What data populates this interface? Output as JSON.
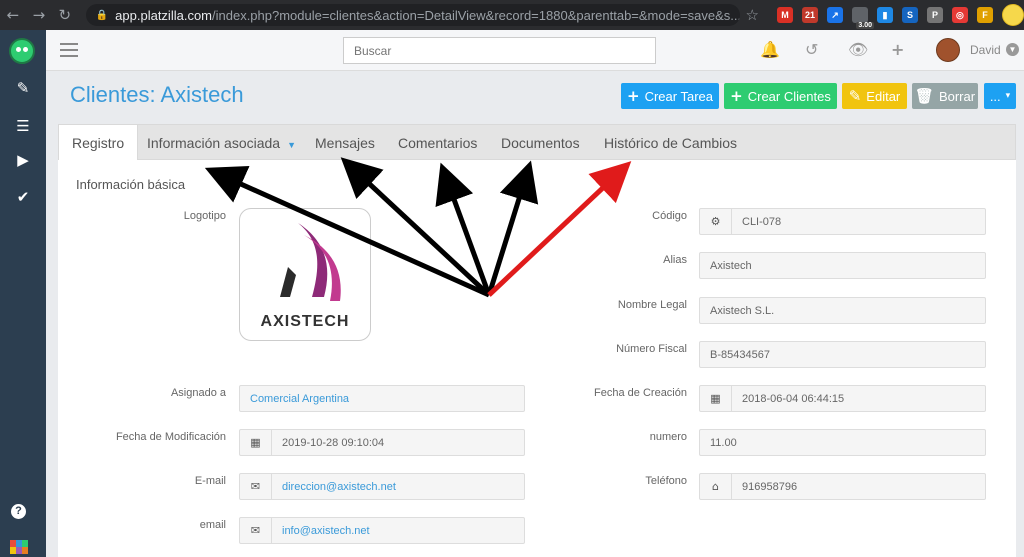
{
  "browser": {
    "back_icon": "←",
    "forward_icon": "→",
    "reload_icon": "↻",
    "url_host": "app.platzilla.com",
    "url_path": "/index.php?module=clientes&action=DetailView&record=1880&parenttab=&mode=save&s...",
    "extensions": [
      {
        "name": "m-extension",
        "label": "M",
        "color": "#d93025"
      },
      {
        "name": "calendar-extension",
        "label": "21",
        "color": "#c0392b"
      },
      {
        "name": "arrow-extension",
        "label": "↗",
        "color": "#1a73e8"
      },
      {
        "name": "weather-extension",
        "label": "3.00",
        "color": "#5f6368"
      },
      {
        "name": "chart-extension",
        "label": "▮",
        "color": "#1e88e5"
      },
      {
        "name": "s-extension",
        "label": "S",
        "color": "#1565c0"
      },
      {
        "name": "p-extension",
        "label": "P",
        "color": "#757575"
      },
      {
        "name": "cc-extension",
        "label": "◎",
        "color": "#e53935"
      },
      {
        "name": "f-extension",
        "label": "F",
        "color": "#e0a000"
      }
    ]
  },
  "topbar": {
    "search_placeholder": "Buscar",
    "user_name": "David"
  },
  "header": {
    "title": "Clientes: Axistech",
    "buttons": [
      {
        "name": "crear-tarea-button",
        "label": "Crear Tarea",
        "icon": "+",
        "color": "#1da1f2"
      },
      {
        "name": "crear-clientes-button",
        "label": "Crear Clientes",
        "icon": "+",
        "color": "#2ecc71"
      },
      {
        "name": "editar-button",
        "label": "Editar",
        "icon": "✎",
        "color": "#f1c40f"
      },
      {
        "name": "borrar-button",
        "label": "Borrar",
        "icon": "🗑",
        "color": "#95a5a6"
      },
      {
        "name": "more-button",
        "label": "...",
        "icon": "▾",
        "color": "#1da1f2"
      }
    ]
  },
  "tabs": {
    "registro": "Registro",
    "informacion": "Información asociada",
    "mensajes": "Mensajes",
    "comentarios": "Comentarios",
    "documentos": "Documentos",
    "historico": "Histórico de Cambios"
  },
  "panel": {
    "section_title": "Información básica",
    "logo_label": "Logotipo",
    "logo_text": "AXISTECH",
    "left_fields": [
      {
        "label": "Asignado a",
        "value": "Comercial Argentina",
        "icon": ""
      },
      {
        "label": "Fecha de Modificación",
        "value": "2019-10-28 09:10:04",
        "icon": "calendar-icon"
      },
      {
        "label": "E-mail",
        "value": "direccion@axistech.net",
        "icon": "envelope-icon"
      },
      {
        "label": "email",
        "value": "info@axistech.net",
        "icon": "envelope-icon"
      }
    ],
    "right_fields": [
      {
        "label": "Código",
        "value": "CLI-078",
        "icon": "cogs-icon"
      },
      {
        "label": "Alias",
        "value": "Axistech",
        "icon": ""
      },
      {
        "label": "Nombre Legal",
        "value": "Axistech S.L.",
        "icon": ""
      },
      {
        "label": "Número Fiscal",
        "value": "B-85434567",
        "icon": ""
      },
      {
        "label": "Fecha de Creación",
        "value": "2018-06-04 06:44:15",
        "icon": "calendar-icon"
      },
      {
        "label": "numero",
        "value": "11.00",
        "icon": ""
      },
      {
        "label": "Teléfono",
        "value": "916958796",
        "icon": "home-icon"
      }
    ]
  },
  "annotation_colors": {
    "black_arrow": "#000000",
    "red_arrow": "#e01b1b"
  }
}
